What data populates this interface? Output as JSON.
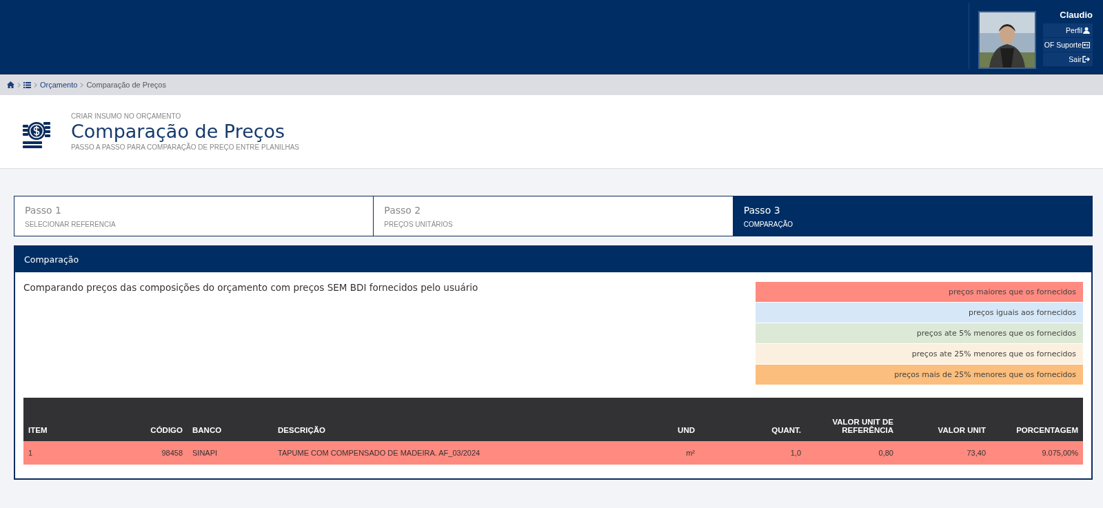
{
  "user": {
    "name": "Claudio",
    "menu": [
      {
        "label": "Perfil",
        "kind": "profile"
      },
      {
        "label": "OF Suporte",
        "kind": "support"
      },
      {
        "label": "Sair",
        "kind": "logout"
      }
    ]
  },
  "breadcrumb": {
    "items": [
      "Orçamento",
      "Comparação de Preços"
    ]
  },
  "page_header": {
    "kicker": "CRIAR INSUMO NO ORÇAMENTO",
    "title": "Comparação de Preços",
    "subtitle": "PASSO A PASSO PARA COMPARAÇÃO DE PREÇO ENTRE PLANILHAS"
  },
  "steps": [
    {
      "title": "Passo 1",
      "label": "SELECIONAR REFERENCIA",
      "selected": false
    },
    {
      "title": "Passo 2",
      "label": "PREÇOS UNITÁRIOS",
      "selected": false
    },
    {
      "title": "Passo 3",
      "label": "COMPARAÇÃO",
      "selected": true
    }
  ],
  "panel": {
    "title": "Comparação",
    "description": "Comparando preços das composições do orçamento com preços SEM BDI fornecidos pelo usuário",
    "legend": [
      {
        "label": "preços maiores que os fornecidos",
        "color": "#ff8a80"
      },
      {
        "label": "preços iguais aos fornecidos",
        "color": "#d6e8f7"
      },
      {
        "label": "preços ate 5% menores que os fornecidos",
        "color": "#dde9d7"
      },
      {
        "label": "preços ate 25% menores que os fornecidos",
        "color": "#fbf0df"
      },
      {
        "label": "preços mais de 25% menores que os fornecidos",
        "color": "#fbbe7c"
      }
    ],
    "table": {
      "columns": [
        "ITEM",
        "CÓDIGO",
        "BANCO",
        "DESCRIÇÃO",
        "UND",
        "QUANT.",
        "VALOR UNIT DE REFERÊNCIA",
        "VALOR UNIT",
        "PORCENTAGEM"
      ],
      "rows": [
        {
          "color": "#ff8a80",
          "cells": [
            "1",
            "98458",
            "SINAPI",
            "TAPUME COM COMPENSADO DE MADEIRA. AF_03/2024",
            "m²",
            "1,0",
            "0,80",
            "73,40",
            "9.075,00%"
          ]
        }
      ]
    }
  }
}
